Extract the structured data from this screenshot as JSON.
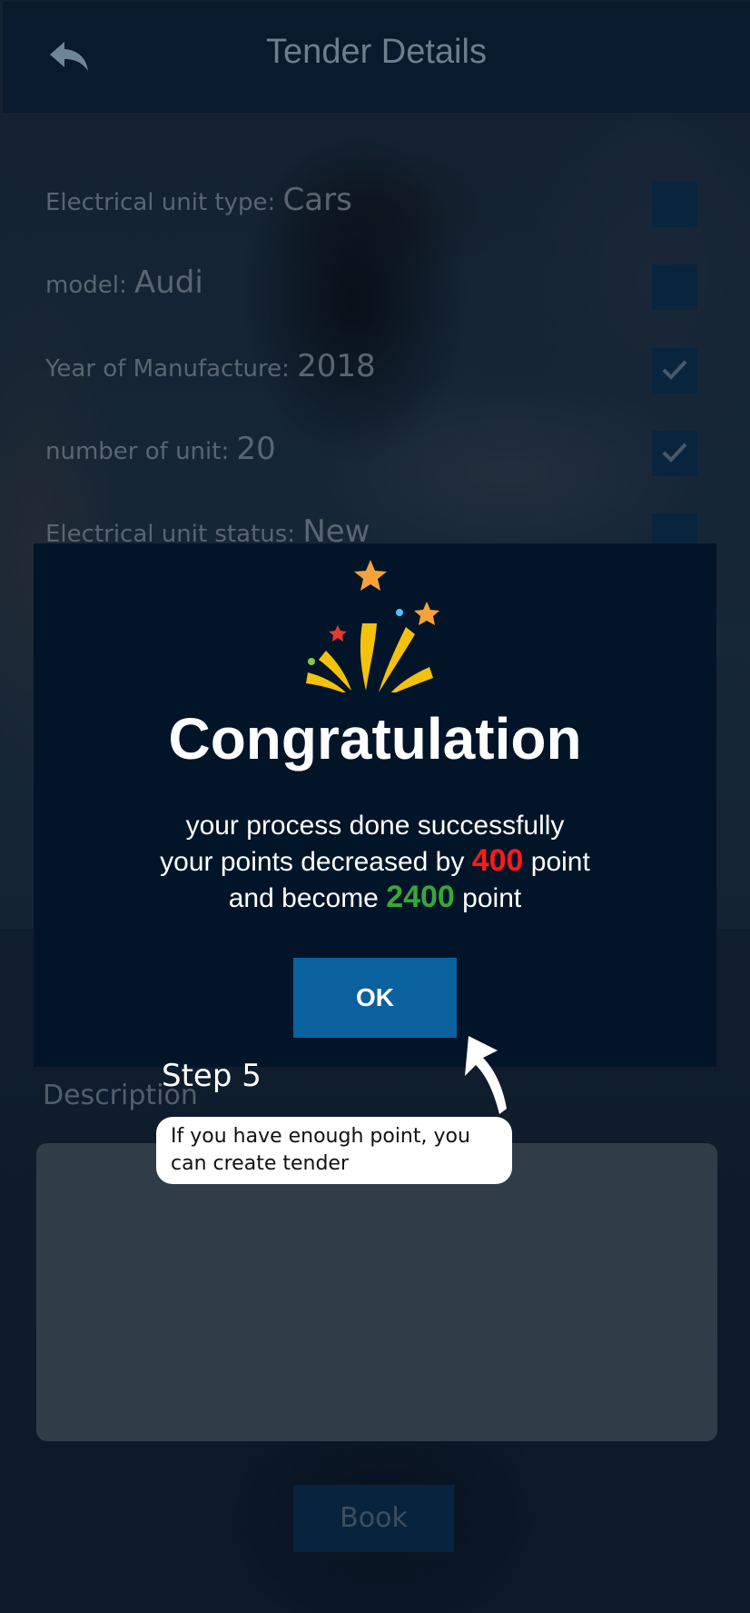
{
  "appbar": {
    "title": "Tender Details"
  },
  "fields": [
    {
      "label": "Electrical unit type: ",
      "value": "Cars",
      "checked": false
    },
    {
      "label": " model: ",
      "value": "Audi",
      "checked": false
    },
    {
      "label": "Year of Manufacture: ",
      "value": "2018",
      "checked": true
    },
    {
      "label": "number of unit: ",
      "value": "20",
      "checked": true
    },
    {
      "label": "Electrical unit status: ",
      "value": "New",
      "checked": false
    }
  ],
  "description": {
    "label": "Description",
    "value": ""
  },
  "book_button": "Book",
  "modal": {
    "title": "Congratulation",
    "line1": "your process done successfully",
    "line2_prefix": "your points decreased by ",
    "decrease": "400",
    "line2_suffix": " point",
    "line3_prefix": "and become ",
    "new_total": "2400",
    "line3_suffix": " point",
    "ok_label": "OK"
  },
  "tutorial": {
    "step": "Step 5",
    "tip": "If you have enough point, you can create tender"
  },
  "colors": {
    "accent": "#0b619e",
    "decrease": "#ff1a1a",
    "total": "#3aa53a"
  }
}
